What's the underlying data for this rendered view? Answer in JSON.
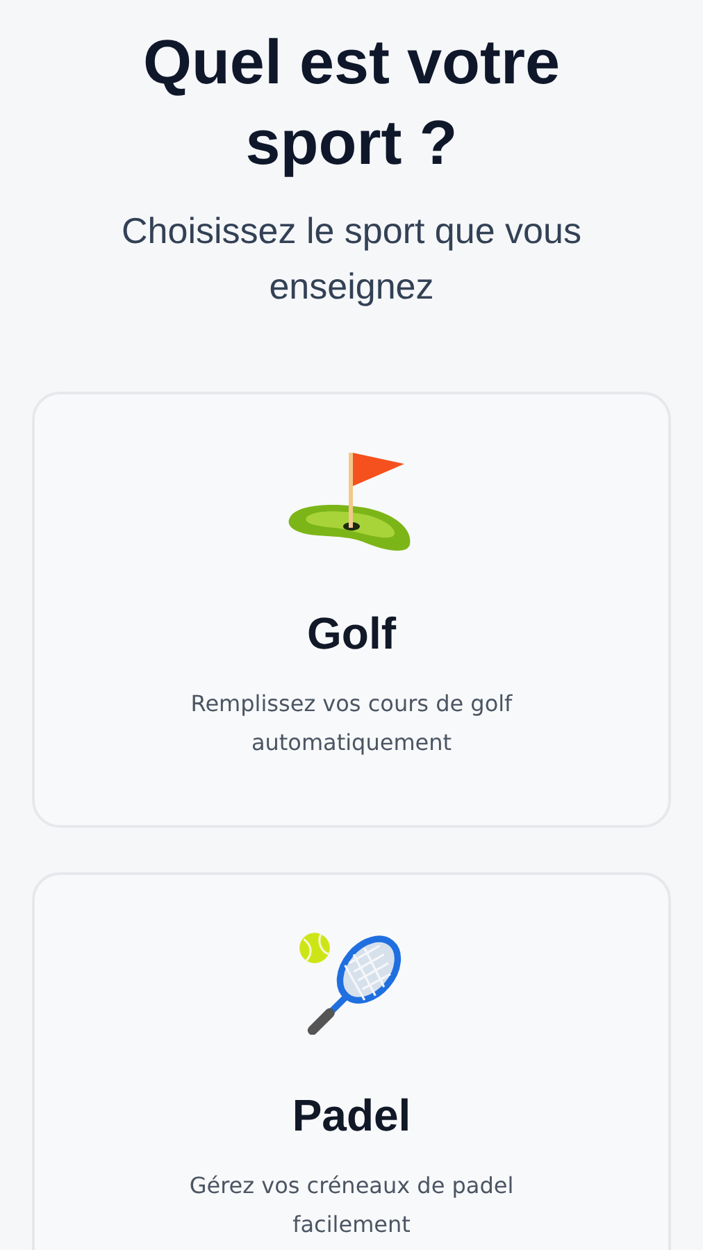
{
  "title": "Quel est votre sport ?",
  "subtitle": "Choisissez le sport que vous enseignez",
  "sports": [
    {
      "kind": "golf",
      "name": "Golf",
      "description": "Remplissez vos cours de golf automatiquement"
    },
    {
      "kind": "padel",
      "name": "Padel",
      "description": "Gérez vos créneaux de padel facilement"
    }
  ]
}
